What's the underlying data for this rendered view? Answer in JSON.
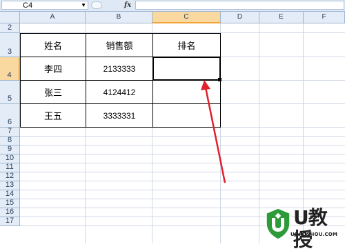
{
  "formula_bar": {
    "name_box": "C4",
    "fx_icon": "fx-icon",
    "formula": ""
  },
  "columns": [
    "A",
    "B",
    "C",
    "D",
    "E",
    "F"
  ],
  "rows": [
    "2",
    "3",
    "4",
    "5",
    "6",
    "7",
    "8",
    "9",
    "10",
    "11",
    "12",
    "13",
    "14",
    "15",
    "16",
    "17"
  ],
  "selected_cell": "C4",
  "table": {
    "headers": [
      "姓名",
      "销售额",
      "排名"
    ],
    "rows": [
      {
        "name": "李四",
        "sales": "2133333",
        "rank": ""
      },
      {
        "name": "张三",
        "sales": "4124412",
        "rank": ""
      },
      {
        "name": "王五",
        "sales": "3333331",
        "rank": ""
      }
    ]
  },
  "annotation": {
    "arrow_color": "#e0202a"
  },
  "watermark": {
    "brand": "U教授",
    "url": "UJIAOSHOU.COM",
    "shield_color": "#2e9b3a"
  }
}
